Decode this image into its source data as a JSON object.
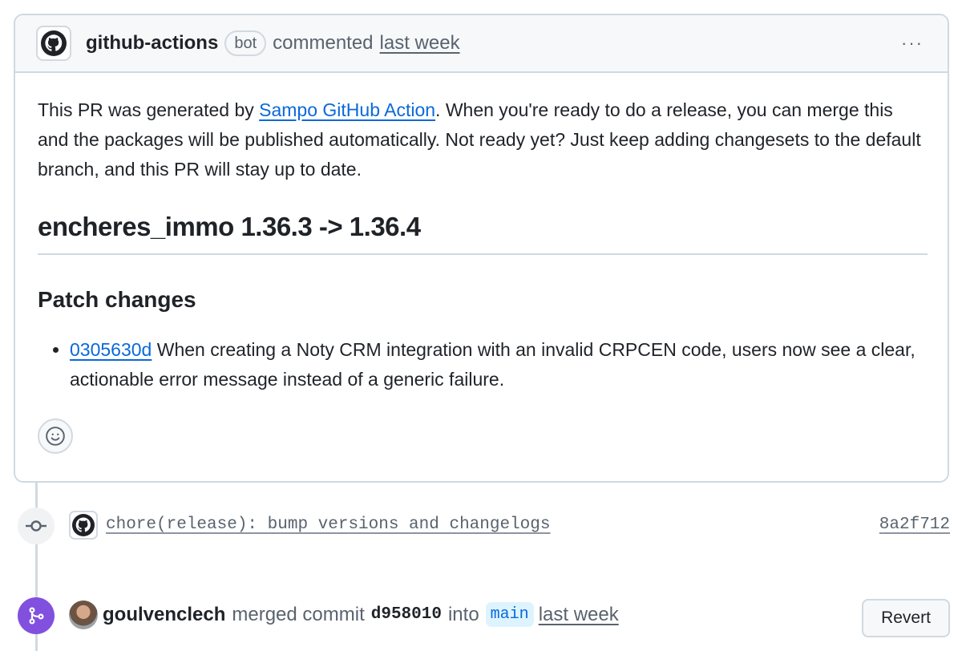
{
  "comment": {
    "author": "github-actions",
    "author_badge": "bot",
    "action": "commented",
    "time": "last week",
    "menu_label": "···",
    "intro_before_link": "This PR was generated by ",
    "intro_link": "Sampo GitHub Action",
    "intro_after_link": ". When you're ready to do a release, you can merge this and the packages will be published automatically. Not ready yet? Just keep adding changesets to the default branch, and this PR will stay up to date.",
    "heading": "encheres_immo 1.36.3 -> 1.36.4",
    "subheading": "Patch changes",
    "changes": [
      {
        "sha": "0305630d",
        "text": " When creating a Noty CRM integration with an invalid CRPCEN code, users now see a clear, actionable error message instead of a generic failure."
      }
    ]
  },
  "commit": {
    "message": "chore(release): bump versions and changelogs",
    "sha": "8a2f712"
  },
  "merge": {
    "user": "goulvenclech",
    "action": "merged commit",
    "sha": "d958010",
    "into": "into",
    "branch": "main",
    "time": "last week",
    "revert_label": "Revert"
  },
  "icons": {
    "author_avatar": "github-logo-icon",
    "kebab": "kebab-horizontal-icon",
    "emoji": "smiley-icon",
    "commit": "git-commit-icon",
    "merge": "git-merge-icon"
  },
  "colors": {
    "link": "#0969da",
    "merge_badge": "#8250df",
    "border": "#d1d9e0",
    "muted": "#59636e"
  }
}
